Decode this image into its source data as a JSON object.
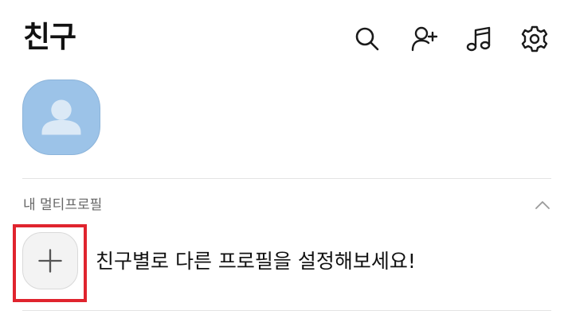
{
  "header": {
    "title": "친구",
    "icons": [
      "search-icon",
      "add-friend-icon",
      "music-icon",
      "settings-icon"
    ]
  },
  "my_profile": {
    "avatar_icon": "person-icon",
    "avatar_color": "#9cc3e8"
  },
  "multi_profile": {
    "section_label": "내 멀티프로필",
    "collapse_icon": "chevron-up-icon",
    "add_icon": "plus-icon",
    "prompt": "친구별로 다른 프로필을 설정해보세요!",
    "highlight_color": "#e0242e"
  }
}
